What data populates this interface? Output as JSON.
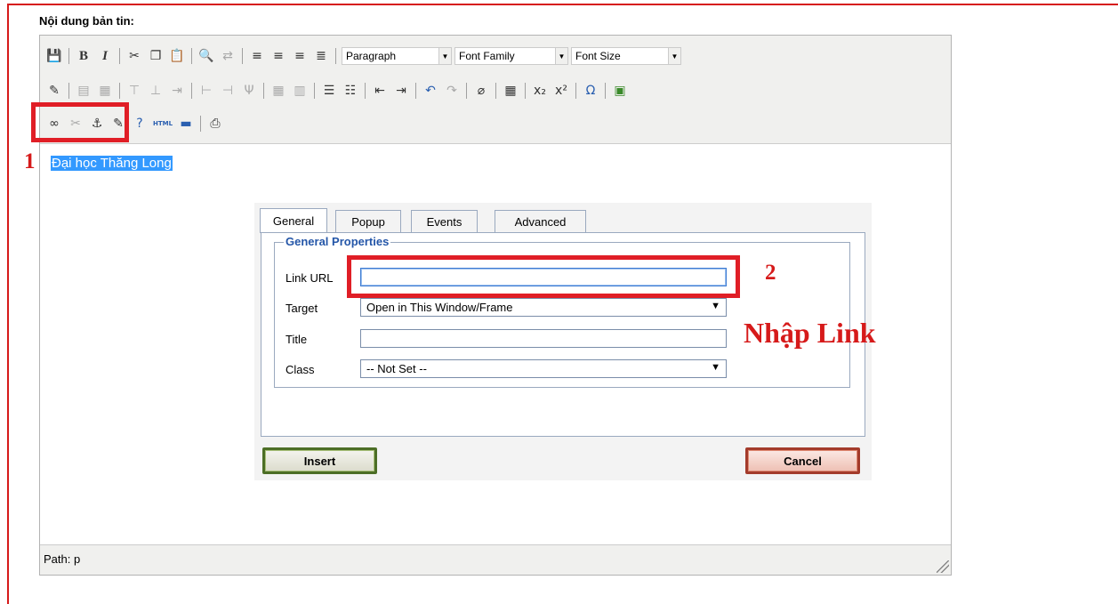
{
  "page": {
    "field_label": "Nội dung bản tin:"
  },
  "toolbar": {
    "paragraph": "Paragraph",
    "font_family": "Font Family",
    "font_size": "Font Size"
  },
  "editor": {
    "selected_text": "Đại học Thăng Long",
    "status_path": "Path: p"
  },
  "dialog": {
    "tabs": [
      "General",
      "Popup",
      "Events",
      "Advanced"
    ],
    "legend": "General Properties",
    "labels": {
      "link_url": "Link URL",
      "target": "Target",
      "title": "Title",
      "class": "Class"
    },
    "values": {
      "link_url": "",
      "target": "Open in This Window/Frame",
      "title": "",
      "class": "-- Not Set --"
    },
    "buttons": {
      "insert": "Insert",
      "cancel": "Cancel"
    }
  },
  "annotations": {
    "step1": "1",
    "step2": "2",
    "note": "Nhập Link"
  },
  "colors": {
    "annotation_red": "#e01e26",
    "selection_blue": "#3399ff",
    "legend_blue": "#2456a8"
  }
}
